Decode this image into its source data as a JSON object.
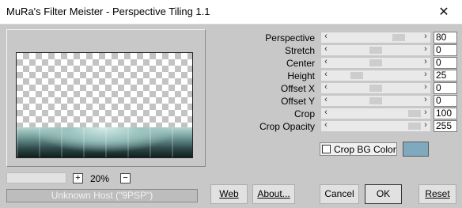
{
  "window": {
    "title": "MuRa's Filter Meister - Perspective Tiling 1.1",
    "close_glyph": "✕"
  },
  "preview": {
    "zoom_plus": "+",
    "zoom_minus": "−",
    "zoom_level": "20%"
  },
  "status": {
    "text": "Unknown Host (\"9PSP\")"
  },
  "params": [
    {
      "label": "Perspective",
      "value": "80",
      "level": 0.8
    },
    {
      "label": "Stretch",
      "value": "0",
      "level": 0.5
    },
    {
      "label": "Center",
      "value": "0",
      "level": 0.5
    },
    {
      "label": "Height",
      "value": "25",
      "level": 0.25
    },
    {
      "label": "Offset X",
      "value": "0",
      "level": 0.5
    },
    {
      "label": "Offset Y",
      "value": "0",
      "level": 0.5
    },
    {
      "label": "Crop",
      "value": "100",
      "level": 1.0
    },
    {
      "label": "Crop Opacity",
      "value": "255",
      "level": 1.0
    }
  ],
  "crop_bg": {
    "label": "Crop BG Color",
    "checked": false,
    "color": "#7fa9be"
  },
  "buttons": {
    "web": "Web",
    "about": "About...",
    "cancel": "Cancel",
    "ok": "OK",
    "reset": "Reset"
  },
  "icons": {
    "left_arrow": "‹",
    "right_arrow": "›"
  }
}
